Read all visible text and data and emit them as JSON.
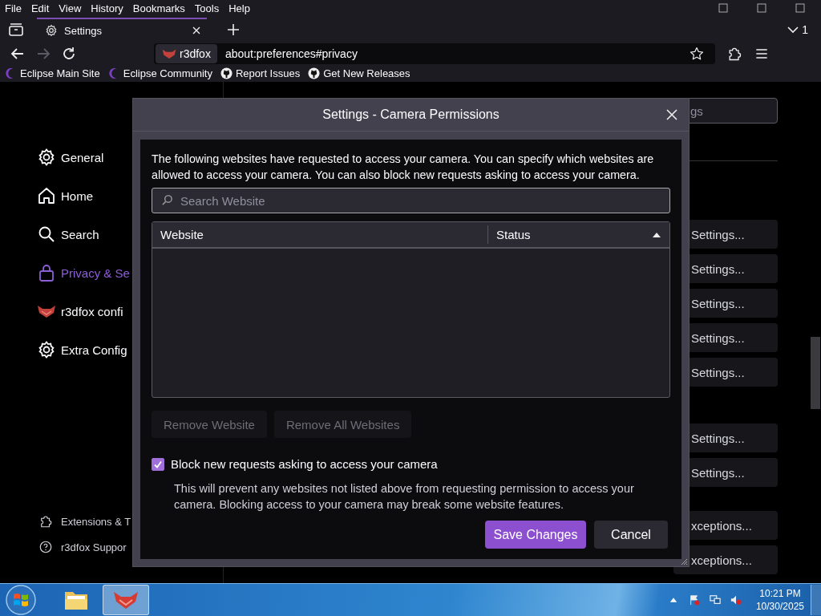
{
  "menu_bar": {
    "items": [
      "File",
      "Edit",
      "View",
      "History",
      "Bookmarks",
      "Tools",
      "Help"
    ]
  },
  "tab_bar": {
    "tabs": [
      {
        "label": "Settings",
        "selected": true
      }
    ],
    "tab_count": "1"
  },
  "nav_bar": {
    "identity": "r3dfox",
    "url": "about:preferences#privacy",
    "forward_disabled": true
  },
  "bookmarks": [
    {
      "label": "Eclipse Main Site",
      "kind": "crescent"
    },
    {
      "label": "Eclipse Community",
      "kind": "crescent"
    },
    {
      "label": "Report Issues",
      "kind": "cat"
    },
    {
      "label": "Get New Releases",
      "kind": "cat"
    }
  ],
  "sidebar": {
    "items": [
      {
        "label": "General",
        "kind": "gear",
        "selected": false
      },
      {
        "label": "Home",
        "kind": "home",
        "selected": false
      },
      {
        "label": "Search",
        "kind": "search",
        "selected": false
      },
      {
        "label": "Privacy & Se",
        "kind": "lock",
        "selected": true
      },
      {
        "label": "r3dfox confi",
        "kind": "fox",
        "selected": false
      },
      {
        "label": "Extra Config",
        "kind": "gear",
        "selected": false
      }
    ],
    "footer": [
      {
        "label": "Extensions & T",
        "kind": "puzzle"
      },
      {
        "label": "r3dfox Suppor",
        "kind": "help"
      }
    ]
  },
  "content": {
    "search_placeholder": "gs",
    "groups": [
      [
        "Settings...",
        "Settings...",
        "Settings...",
        "Settings...",
        "Settings..."
      ],
      [
        "Settings...",
        "Settings..."
      ],
      [
        "xceptions...",
        "xceptions..."
      ]
    ]
  },
  "dialog": {
    "title": "Settings - Camera Permissions",
    "description": "The following websites have requested to access your camera. You can specify which websites are allowed to access your camera. You can also block new requests asking to access your camera.",
    "search": {
      "placeholder": "Search Website"
    },
    "table": {
      "columns": [
        {
          "label": "Website",
          "sorted": false
        },
        {
          "label": "Status",
          "sorted": true
        }
      ]
    },
    "buttons": [
      {
        "label": "Remove Website",
        "disabled": true
      },
      {
        "label": "Remove All Websites",
        "disabled": true
      }
    ],
    "block": {
      "label": "Block new requests asking to access your camera",
      "checked": true,
      "note": "This will prevent any websites not listed above from requesting permission to access your camera. Blocking access to your camera may break some website features."
    },
    "actions": [
      {
        "label": "Save Changes",
        "kind": "primary"
      },
      {
        "label": "Cancel",
        "kind": "secondary"
      }
    ]
  },
  "taskbar": {
    "apps": [
      {
        "kind": "folder",
        "selected": false
      },
      {
        "kind": "fox",
        "selected": true
      }
    ],
    "time": "10:21 PM",
    "date": "10/30/2025"
  }
}
